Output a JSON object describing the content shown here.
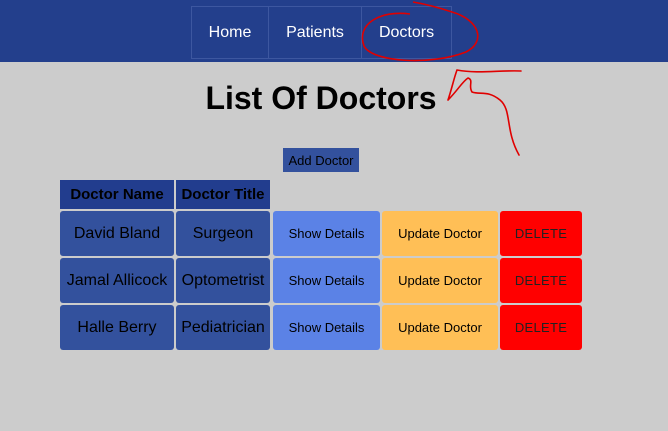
{
  "nav": {
    "items": [
      "Home",
      "Patients",
      "Doctors"
    ]
  },
  "page": {
    "title": "List Of Doctors",
    "add_button_label": "Add Doctor"
  },
  "table": {
    "headers": [
      "Doctor Name",
      "Doctor Title"
    ],
    "rows": [
      {
        "name": "David Bland",
        "title": "Surgeon"
      },
      {
        "name": "Jamal Allicock",
        "title": "Optometrist"
      },
      {
        "name": "Halle Berry",
        "title": "Pediatrician"
      }
    ],
    "actions": {
      "show": "Show Details",
      "update": "Update Doctor",
      "delete": "DELETE"
    }
  },
  "colors": {
    "topbar": "#233f8c",
    "header_cell": "#223d8e",
    "data_cell": "#33519d",
    "show_button": "#5b82e6",
    "update_button": "#ffbf56",
    "delete_button": "#ff0000",
    "annotation": "#e00000"
  }
}
